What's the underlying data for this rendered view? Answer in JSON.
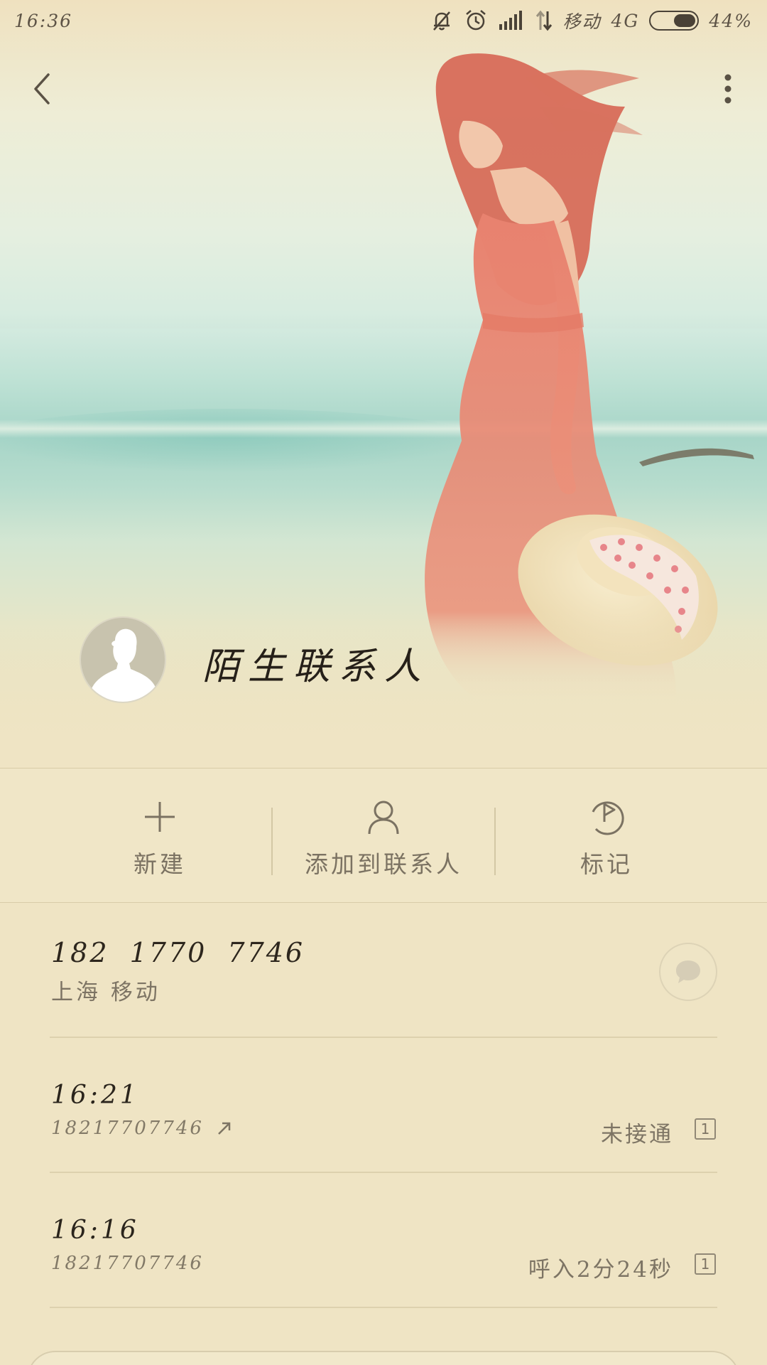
{
  "status_bar": {
    "time": "16:36",
    "carrier": "移动",
    "network": "4G",
    "battery": "44%"
  },
  "contact": {
    "name": "陌生联系人"
  },
  "actions": [
    {
      "label": "新建",
      "icon": "plus-icon"
    },
    {
      "label": "添加到联系人",
      "icon": "person-icon"
    },
    {
      "label": "标记",
      "icon": "flag-icon"
    }
  ],
  "phone": {
    "number": "182 1770 7746",
    "location": "上海 移动"
  },
  "call_log": [
    {
      "time": "16:21",
      "number": "18217707746",
      "direction": "outgoing",
      "status": "未接通",
      "count": "1"
    },
    {
      "time": "16:16",
      "number": "18217707746",
      "direction": "incoming",
      "status": "呼入2分24秒",
      "count": "1"
    }
  ],
  "colors": {
    "background": "#efe4c4",
    "dress": "#e8826f",
    "sea": "#a7d5c8"
  }
}
